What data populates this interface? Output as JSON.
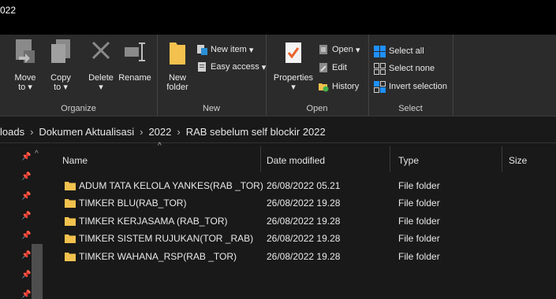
{
  "window": {
    "title_fragment": "022"
  },
  "ribbon": {
    "organize": {
      "label": "Organize",
      "move": "Move",
      "move_to": "to",
      "copy": "Copy",
      "copy_to": "to",
      "delete": "Delete",
      "rename": "Rename"
    },
    "new": {
      "label": "New",
      "new_folder_line1": "New",
      "new_folder_line2": "folder",
      "new_item": "New item",
      "easy_access": "Easy access"
    },
    "open": {
      "label": "Open",
      "properties": "Properties",
      "open": "Open",
      "edit": "Edit",
      "history": "History"
    },
    "select": {
      "label": "Select",
      "select_all": "Select all",
      "select_none": "Select none",
      "invert_selection": "Invert selection"
    }
  },
  "address": {
    "crumbs": [
      "loads",
      "Dokumen Aktualisasi",
      "2022",
      "RAB sebelum self blockir 2022"
    ]
  },
  "columns": {
    "name": "Name",
    "date": "Date modified",
    "type": "Type",
    "size": "Size"
  },
  "files": [
    {
      "name": "ADUM TATA KELOLA YANKES(RAB _TOR)",
      "date": "26/08/2022 05.21",
      "type": "File folder"
    },
    {
      "name": "TIMKER BLU(RAB_TOR)",
      "date": "26/08/2022 19.28",
      "type": "File folder"
    },
    {
      "name": "TIMKER KERJASAMA (RAB_TOR)",
      "date": "26/08/2022 19.28",
      "type": "File folder"
    },
    {
      "name": "TIMKER SISTEM RUJUKAN(TOR _RAB)",
      "date": "26/08/2022 19.28",
      "type": "File folder"
    },
    {
      "name": "TIMKER WAHANA_RSP(RAB _TOR)",
      "date": "26/08/2022 19.28",
      "type": "File folder"
    }
  ],
  "colors": {
    "folder": "#f2c14e",
    "accent": "#1e90ff",
    "background": "#191919"
  }
}
